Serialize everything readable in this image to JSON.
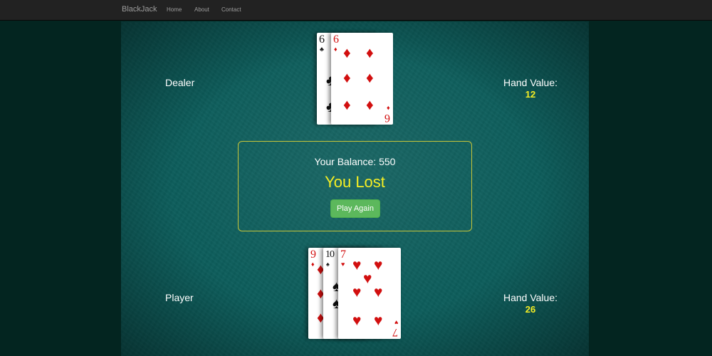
{
  "navbar": {
    "brand": "BlackJack",
    "links": [
      "Home",
      "About",
      "Contact"
    ]
  },
  "dealer": {
    "label": "Dealer",
    "hand_value_label": "Hand Value:",
    "hand_value": "12",
    "cards": [
      {
        "rank": "6",
        "suit": "♣",
        "color": "black"
      },
      {
        "rank": "6",
        "suit": "♦",
        "color": "red"
      }
    ]
  },
  "player": {
    "label": "Player",
    "hand_value_label": "Hand Value:",
    "hand_value": "26",
    "cards": [
      {
        "rank": "9",
        "suit": "♦",
        "color": "red"
      },
      {
        "rank": "10",
        "suit": "♠",
        "color": "black"
      },
      {
        "rank": "7",
        "suit": "♥",
        "color": "red"
      }
    ]
  },
  "result": {
    "balance_text": "Your Balance: 550",
    "status": "You Lost",
    "play_again_label": "Play Again"
  },
  "colors": {
    "felt": "#0d5e5c",
    "background": "#032520",
    "accent_yellow": "#f5ee24",
    "button_green": "#5cb85c"
  }
}
